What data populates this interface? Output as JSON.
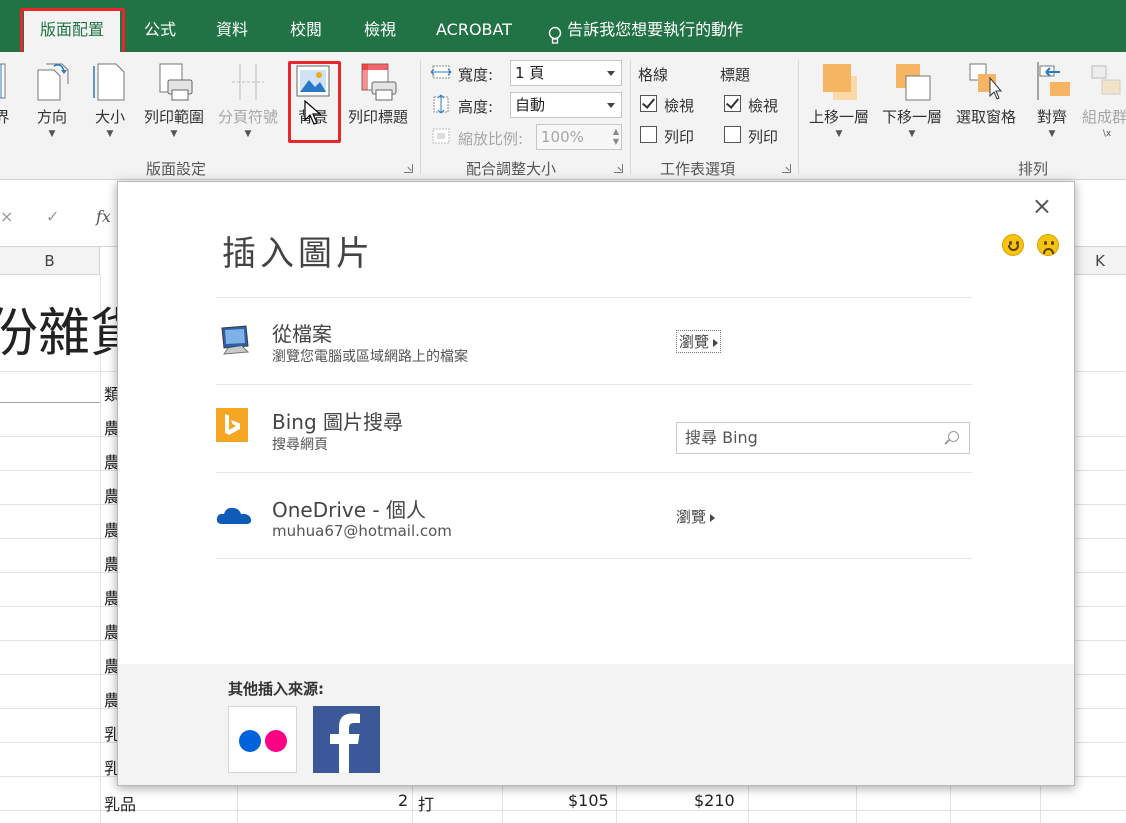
{
  "tabs": [
    {
      "label": "版面配置",
      "active": true
    },
    {
      "label": "公式"
    },
    {
      "label": "資料"
    },
    {
      "label": "校閱"
    },
    {
      "label": "檢視"
    },
    {
      "label": "ACROBAT"
    },
    {
      "label": "告訴我您想要執行的動作"
    }
  ],
  "ribbon": {
    "page_setup": {
      "edge_label": "界",
      "orientation": "方向",
      "size": "大小",
      "print_area": "列印範圍",
      "breaks": "分頁符號",
      "background": "背景",
      "print_titles": "列印標題",
      "group_label": "版面設定"
    },
    "scale_to_fit": {
      "width_label": "寬度:",
      "width_value": "1 頁",
      "height_label": "高度:",
      "height_value": "自動",
      "scale_label": "縮放比例:",
      "scale_value": "100%",
      "group_label": "配合調整大小"
    },
    "sheet_options": {
      "gridlines_label": "格線",
      "headings_label": "標題",
      "view_label": "檢視",
      "print_label": "列印",
      "gridlines_view": true,
      "gridlines_print": false,
      "headings_view": true,
      "headings_print": false,
      "group_label": "工作表選項"
    },
    "arrange": {
      "bring_forward": "上移一層",
      "send_backward": "下移一層",
      "selection_pane": "選取窗格",
      "align": "對齊",
      "group": "組成群",
      "group_sub": "\\x",
      "group_label": "排列"
    }
  },
  "formula_bar": {
    "cancel": "×",
    "enter": "✓",
    "fx": "fx"
  },
  "sheet": {
    "col_b": "B",
    "col_k": "K",
    "title_fragment": "份雜貨",
    "header_fragment": "類",
    "rows": [
      {
        "b": "農"
      },
      {
        "b": "農"
      },
      {
        "b": "農"
      },
      {
        "b": "農"
      },
      {
        "b": "農"
      },
      {
        "b": "農"
      },
      {
        "b": "農"
      },
      {
        "b": "農"
      },
      {
        "b": "農"
      },
      {
        "b": "乳"
      },
      {
        "b": "乳"
      }
    ],
    "last_row": {
      "category": "乳品",
      "qty": "2",
      "unit": "打",
      "price": "$105",
      "total": "$210"
    }
  },
  "dialog": {
    "title": "插入圖片",
    "close": "×",
    "sources": [
      {
        "title": "從檔案",
        "subtitle": "瀏覽您電腦或區域網路上的檔案",
        "action": "瀏覽"
      },
      {
        "title": "Bing 圖片搜尋",
        "subtitle": "搜尋網頁",
        "placeholder": "搜尋 Bing"
      },
      {
        "title": "OneDrive - 個人",
        "subtitle": "muhua67@hotmail.com",
        "action": "瀏覽"
      }
    ],
    "other_sources_label": "其他插入來源:",
    "other_sources": [
      "flickr-icon",
      "facebook-icon"
    ]
  },
  "colors": {
    "excel_green": "#217346",
    "highlight_red": "#e8262c",
    "bing_orange": "#f5a623",
    "onedrive_blue": "#0f5cb8",
    "facebook_blue": "#3b5998"
  }
}
